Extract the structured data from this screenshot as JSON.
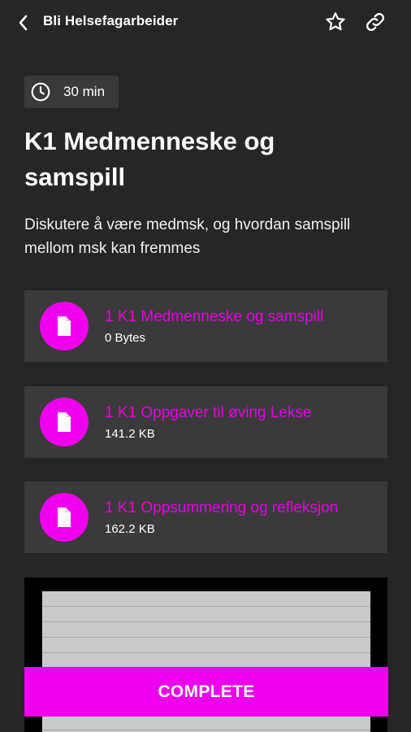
{
  "header": {
    "back_label": "Bli Helsefagarbeider",
    "icons": [
      "chevron-left-icon",
      "star-icon",
      "link-icon"
    ]
  },
  "lesson": {
    "duration": "30 min",
    "title": "K1 Medmenneske og samspill",
    "description": "Diskutere å være medmsk, og hvordan samspill mellom msk kan fremmes"
  },
  "files": [
    {
      "name": "1 K1 Medmenneske og samspill",
      "size": "0 Bytes"
    },
    {
      "name": "1 K1 Oppgaver til øving Lekse",
      "size": "141.2 KB"
    },
    {
      "name": "1 K1 Oppsummering og refleksjon",
      "size": "162.2 KB"
    }
  ],
  "actions": {
    "complete_label": "COMPLETE"
  },
  "colors": {
    "accent": "#ee00ee",
    "background": "#262626",
    "card": "#3a3a3a"
  }
}
